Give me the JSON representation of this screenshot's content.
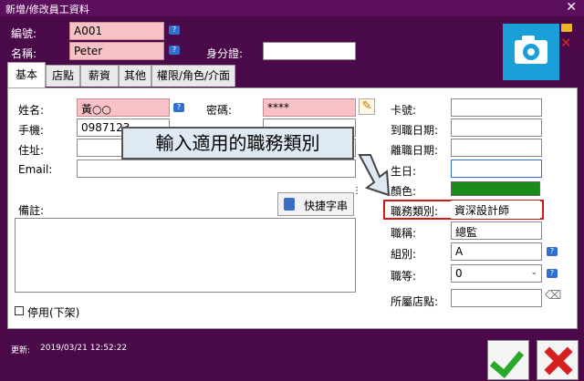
{
  "window": {
    "title": "新增/修改員工資料",
    "close": "✕"
  },
  "header": {
    "id_label": "編號:",
    "id_value": "A001",
    "name_label": "名稱:",
    "name_value": "Peter",
    "idcard_label": "身分證:",
    "idcard_value": ""
  },
  "tabs": [
    "基本",
    "店點",
    "薪資",
    "其他",
    "權限/角色/介面"
  ],
  "basic": {
    "surname_label": "姓名:",
    "surname_value": "黃○○",
    "password_label": "密碼:",
    "password_value": "****",
    "mobile_label": "手機:",
    "mobile_value": "0987123",
    "address_label": "住址:",
    "address_value": "",
    "email_label": "Email:",
    "email_value": "",
    "remarks_label": "備註:",
    "remarks_value": "",
    "quick_btn_label": "快捷字串",
    "disable_label": "停用(下架)"
  },
  "right": {
    "card_label": "卡號:",
    "card_value": "",
    "hire_label": "到職日期:",
    "hire_value": "",
    "leave_label": "離職日期:",
    "leave_value": "",
    "birthday_label": "生日:",
    "birthday_value": "",
    "color_label": "顏色:",
    "color_value": "#1a8a1a",
    "jobtype_label": "職務類別:",
    "jobtype_value": "資深設計師",
    "title_label": "職稱:",
    "title_value": "總監",
    "group_label": "組別:",
    "group_value": "A",
    "rank_label": "職等:",
    "rank_value": "0",
    "store_label": "所屬店點:",
    "store_value": ""
  },
  "callout": {
    "text": "輸入適用的職務類別"
  },
  "footer": {
    "updated_label": "更新:",
    "updated_value": "2019/03/21 12:52:22"
  }
}
